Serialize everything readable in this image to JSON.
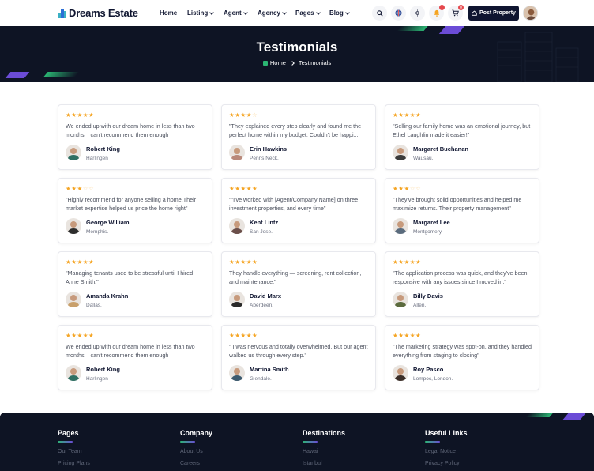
{
  "header": {
    "logo_text": "Dreams Estate",
    "nav": [
      {
        "label": "Home",
        "has_menu": false
      },
      {
        "label": "Listing",
        "has_menu": true
      },
      {
        "label": "Agent",
        "has_menu": true
      },
      {
        "label": "Agency",
        "has_menu": true
      },
      {
        "label": "Pages",
        "has_menu": true
      },
      {
        "label": "Blog",
        "has_menu": true
      }
    ],
    "cart_badge": "0",
    "post_property_label": "Post Property"
  },
  "banner": {
    "title": "Testimonials",
    "breadcrumb_home": "Home",
    "breadcrumb_current": "Testimonials"
  },
  "testimonials": [
    {
      "stars": 5,
      "quote": "We ended up with our dream home in less than two months! I can't recommend them enough",
      "name": "Robert King",
      "location": "Harlingen",
      "avatar_color": "#2f6f63"
    },
    {
      "stars": 4,
      "quote": "\"They explained every step clearly and found me the perfect home within my budget. Couldn't be happi...",
      "name": "Erin Hawkins",
      "location": "Penns Neck.",
      "avatar_color": "#b9897a"
    },
    {
      "stars": 5,
      "quote": "\"Selling our family home was an emotional journey, but Ethel Laughlin made it easier!\"",
      "name": "Margaret Buchanan",
      "location": "Wausau.",
      "avatar_color": "#3b3b3b"
    },
    {
      "stars": 3,
      "quote": "\"Highly recommend for anyone selling a home.Their market expertise helped us price the home right\"",
      "name": "George William",
      "location": "Memphis.",
      "avatar_color": "#2d2d2d"
    },
    {
      "stars": 5,
      "quote": "\"\"I've worked with [Agent/Company Name] on three investment properties, and every time\"",
      "name": "Kent Lintz",
      "location": "San Jose.",
      "avatar_color": "#6b4f4a"
    },
    {
      "stars": 3,
      "quote": "\"They've brought solid opportunities and helped me maximize returns. Their property management\"",
      "name": "Margaret Lee",
      "location": "Montgomery.",
      "avatar_color": "#5a6b7d"
    },
    {
      "stars": 5,
      "quote": "\"Managing tenants used to be stressful until I hired Anne Smith.\"",
      "name": "Amanda Krahn",
      "location": "Dallas.",
      "avatar_color": "#c9a06b"
    },
    {
      "stars": 5,
      "quote": "They handle everything — screening, rent collection, and maintenance.\"",
      "name": "David Marx",
      "location": "Aberdeen.",
      "avatar_color": "#2a2a2a"
    },
    {
      "stars": 5,
      "quote": "\"The application process was quick, and they've been responsive with any issues since I moved in.\"",
      "name": "Billy Davis",
      "location": "Allen.",
      "avatar_color": "#5c6b3e"
    },
    {
      "stars": 5,
      "quote": "We ended up with our dream home in less than two months! I can't recommend them enough",
      "name": "Robert King",
      "location": "Harlingen",
      "avatar_color": "#2f6f63"
    },
    {
      "stars": 5,
      "quote": "\" I was nervous and totally overwhelmed. But our agent walked us through every step.\"",
      "name": "Martina Smith",
      "location": "Glendale.",
      "avatar_color": "#3d5a6e"
    },
    {
      "stars": 5,
      "quote": "\"The marketing strategy was spot-on, and they handled everything from staging to closing\"",
      "name": "Roy Pasco",
      "location": "Lompoc, London.",
      "avatar_color": "#3a2e28"
    }
  ],
  "footer": {
    "columns": [
      {
        "title": "Pages",
        "links": [
          "Our Team",
          "Pricing Plans"
        ]
      },
      {
        "title": "Company",
        "links": [
          "About Us",
          "Careers"
        ]
      },
      {
        "title": "Destinations",
        "links": [
          "Hawai",
          "Istanbul"
        ]
      },
      {
        "title": "Useful Links",
        "links": [
          "Legal Notice",
          "Privacy Policy"
        ]
      }
    ]
  },
  "colors": {
    "dark": "#0e1424",
    "star": "#f5a524",
    "accent_green": "#2bb673",
    "accent_purple": "#6b4cd6"
  }
}
